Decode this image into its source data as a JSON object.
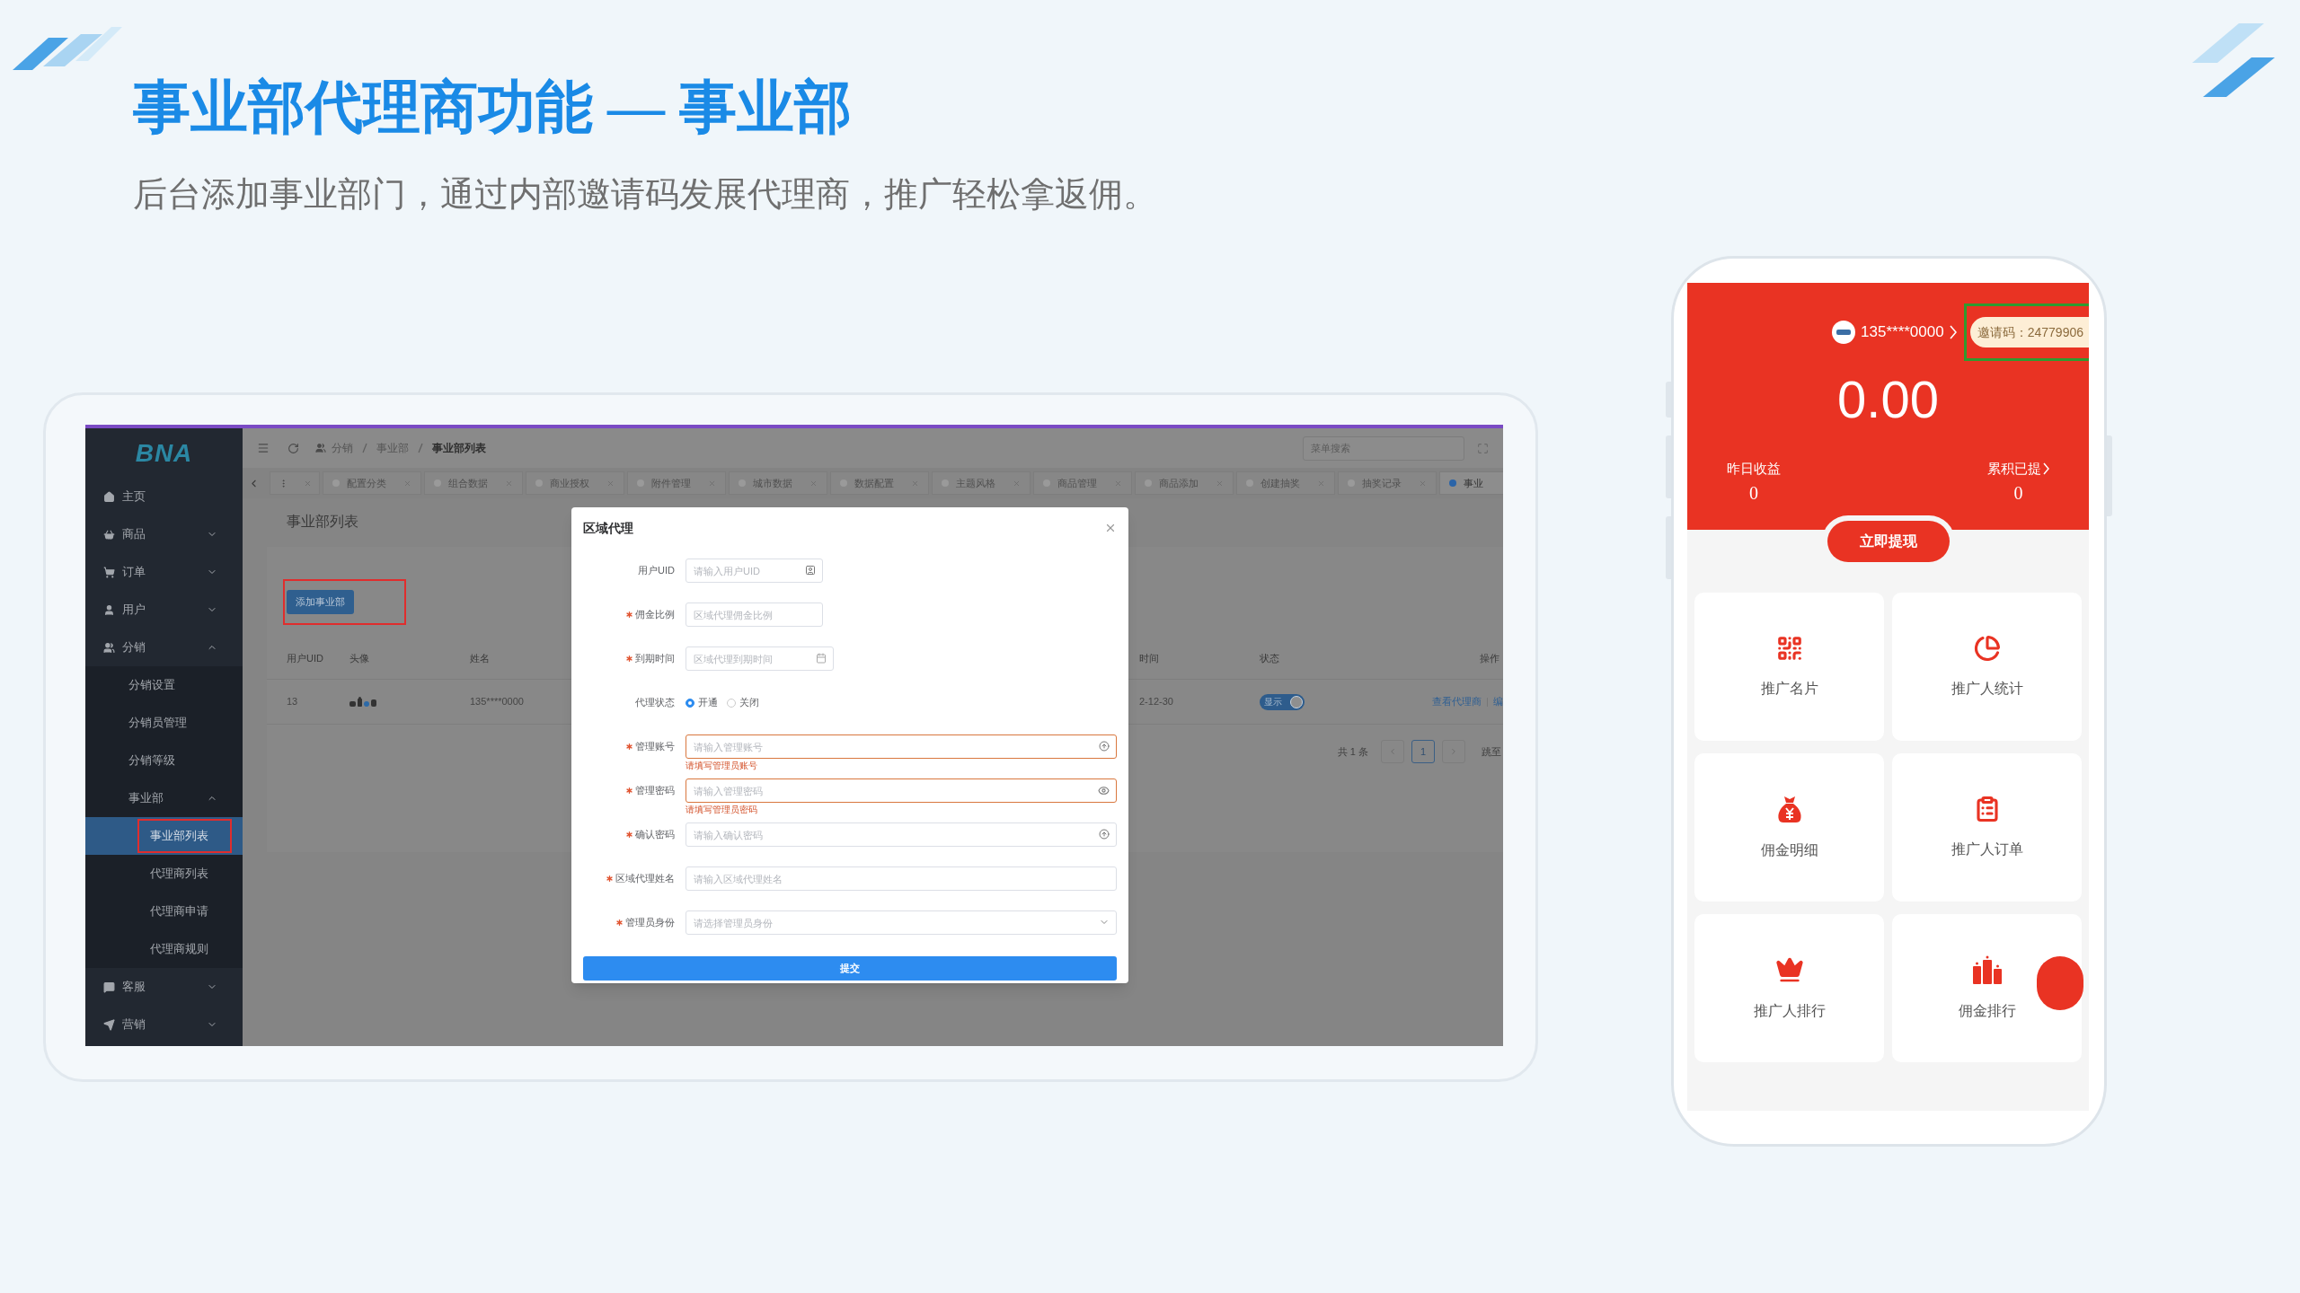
{
  "slide": {
    "title": "事业部代理商功能 — 事业部",
    "subtitle": "后台添加事业部门，通过内部邀请码发展代理商，推广轻松拿返佣。"
  },
  "admin": {
    "logo": "BNA",
    "sidebar": [
      {
        "label": "主页",
        "selected": false
      },
      {
        "label": "商品",
        "selected": false,
        "expanded": false
      },
      {
        "label": "订单",
        "selected": false,
        "expanded": false
      },
      {
        "label": "用户",
        "selected": false,
        "expanded": false
      },
      {
        "label": "分销",
        "selected": false,
        "expanded": true,
        "children": [
          {
            "label": "分销设置",
            "selected": false
          },
          {
            "label": "分销员管理",
            "selected": false
          },
          {
            "label": "分销等级",
            "selected": false
          },
          {
            "label": "事业部",
            "selected": false,
            "expanded": true,
            "children": [
              {
                "label": "事业部列表",
                "selected": true,
                "highlighted": true
              },
              {
                "label": "代理商列表",
                "selected": false,
                "highlighted": false
              },
              {
                "label": "代理商申请",
                "selected": false,
                "highlighted": false
              },
              {
                "label": "代理商规则",
                "selected": false,
                "highlighted": false
              }
            ]
          }
        ]
      },
      {
        "label": "客服",
        "selected": false,
        "expanded": false
      },
      {
        "label": "营销",
        "selected": false,
        "expanded": false
      }
    ],
    "breadcrumb": [
      "分销",
      "事业部",
      "事业部列表"
    ],
    "search": {
      "placeholder": "菜单搜索"
    },
    "tabs": [
      {
        "label": "配置分类",
        "selected": false
      },
      {
        "label": "组合数据",
        "selected": false
      },
      {
        "label": "商业授权",
        "selected": false
      },
      {
        "label": "附件管理",
        "selected": false
      },
      {
        "label": "城市数据",
        "selected": false
      },
      {
        "label": "数据配置",
        "selected": false
      },
      {
        "label": "主题风格",
        "selected": false
      },
      {
        "label": "商品管理",
        "selected": false
      },
      {
        "label": "商品添加",
        "selected": false
      },
      {
        "label": "创建抽奖",
        "selected": false
      },
      {
        "label": "抽奖记录",
        "selected": false
      },
      {
        "label": "事业",
        "selected": true
      }
    ],
    "page_title": "事业部列表",
    "add_button": {
      "label": "添加事业部",
      "highlighted": true
    },
    "table": {
      "columns": [
        "用户UID",
        "头像",
        "姓名",
        "时间",
        "状态",
        "操作"
      ],
      "rows": [
        {
          "uid": "13",
          "name": "135****0000",
          "time": "2-12-30",
          "status": {
            "label": "显示",
            "on": true
          },
          "actions": [
            "查看代理商",
            "编"
          ]
        }
      ]
    },
    "pagination": {
      "total": "共 1 条",
      "pages": [
        {
          "label": "1",
          "selected": true
        }
      ],
      "jump": "跳至"
    },
    "modal": {
      "title": "区域代理",
      "fields": [
        {
          "label": "用户UID",
          "kind": "id",
          "required": false,
          "placeholder": "请输入用户UID"
        },
        {
          "label": "佣金比例",
          "kind": "short",
          "required": true,
          "placeholder": "区域代理佣金比例"
        },
        {
          "label": "到期时间",
          "kind": "date",
          "required": true,
          "placeholder": "区域代理到期时间"
        },
        {
          "label": "代理状态",
          "kind": "radio",
          "required": false,
          "options": [
            {
              "label": "开通",
              "selected": true
            },
            {
              "label": "关闭",
              "selected": false
            }
          ]
        },
        {
          "label": "管理账号",
          "kind": "account",
          "required": true,
          "placeholder": "请输入管理账号",
          "error": "请填写管理员账号"
        },
        {
          "label": "管理密码",
          "kind": "password",
          "required": true,
          "placeholder": "请输入管理密码",
          "error": "请填写管理员密码"
        },
        {
          "label": "确认密码",
          "kind": "account",
          "required": true,
          "placeholder": "请输入确认密码"
        },
        {
          "label": "区域代理姓名",
          "kind": "text",
          "required": true,
          "placeholder": "请输入区域代理姓名"
        },
        {
          "label": "管理员身份",
          "kind": "select",
          "required": true,
          "placeholder": "请选择管理员身份"
        }
      ],
      "submit": "提交"
    }
  },
  "phone": {
    "user": "135****0000",
    "invite": {
      "label": "邀请码：24779906",
      "highlighted": true
    },
    "balance": "0.00",
    "stats": [
      {
        "label": "昨日收益",
        "value": "0",
        "link": false
      },
      {
        "label": "累积已提",
        "value": "0",
        "link": true
      }
    ],
    "withdraw": "立即提现",
    "menu": [
      {
        "label": "推广名片"
      },
      {
        "label": "推广人统计"
      },
      {
        "label": "佣金明细"
      },
      {
        "label": "推广人订单"
      },
      {
        "label": "推广人排行"
      },
      {
        "label": "佣金排行"
      }
    ]
  }
}
